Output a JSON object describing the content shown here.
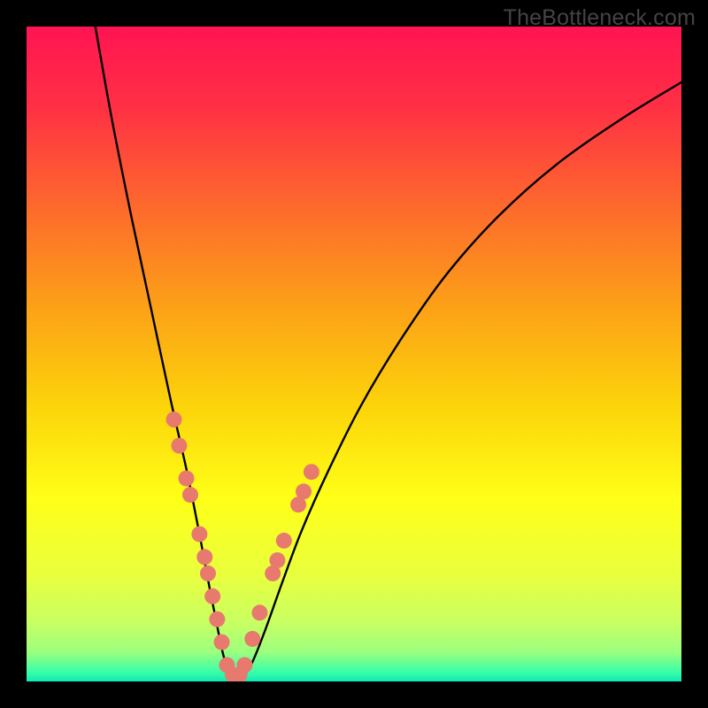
{
  "watermark": "TheBottleneck.com",
  "colors": {
    "frame": "#000000",
    "curve": "#000000",
    "marker_fill": "#e8796f",
    "marker_stroke": "#c95b53",
    "gradient_stops": [
      {
        "offset": 0.0,
        "color": "#ff1452"
      },
      {
        "offset": 0.12,
        "color": "#ff2f45"
      },
      {
        "offset": 0.28,
        "color": "#fd6b2c"
      },
      {
        "offset": 0.44,
        "color": "#fca516"
      },
      {
        "offset": 0.58,
        "color": "#fcd40a"
      },
      {
        "offset": 0.72,
        "color": "#ffff17"
      },
      {
        "offset": 0.84,
        "color": "#e8ff3f"
      },
      {
        "offset": 0.91,
        "color": "#c8ff62"
      },
      {
        "offset": 0.955,
        "color": "#9cff7e"
      },
      {
        "offset": 0.985,
        "color": "#3bffa7"
      },
      {
        "offset": 1.0,
        "color": "#11e8b7"
      }
    ]
  },
  "chart_data": {
    "type": "line",
    "title": "",
    "xlabel": "",
    "ylabel": "",
    "xlim": [
      0,
      100
    ],
    "ylim": [
      0,
      100
    ],
    "note": "Axes have no visible tick labels; values are estimated relative fractions of the plot area. The curve is a V-shaped bottleneck profile with its minimum near x≈31.",
    "series": [
      {
        "name": "bottleneck-curve",
        "x": [
          10.5,
          13,
          16,
          19,
          22,
          24.5,
          26.5,
          28,
          29.2,
          30.2,
          31.5,
          33,
          34.5,
          36.5,
          39,
          42,
          46,
          51,
          57,
          64,
          72,
          81,
          91,
          100
        ],
        "y": [
          100,
          86,
          71,
          57,
          43,
          32,
          22,
          14,
          8,
          3.5,
          0.8,
          0.8,
          3,
          8,
          15,
          23,
          32,
          42,
          52,
          62,
          71,
          79,
          86,
          91.5
        ]
      }
    ],
    "markers": {
      "name": "highlighted-points",
      "points": [
        {
          "x": 22.5,
          "y": 40
        },
        {
          "x": 23.3,
          "y": 36
        },
        {
          "x": 24.4,
          "y": 31
        },
        {
          "x": 25.0,
          "y": 28.5
        },
        {
          "x": 26.4,
          "y": 22.5
        },
        {
          "x": 27.2,
          "y": 19
        },
        {
          "x": 27.7,
          "y": 16.5
        },
        {
          "x": 28.4,
          "y": 13
        },
        {
          "x": 29.1,
          "y": 9.5
        },
        {
          "x": 29.8,
          "y": 6
        },
        {
          "x": 30.6,
          "y": 2.5
        },
        {
          "x": 31.5,
          "y": 1.0
        },
        {
          "x": 32.5,
          "y": 1.0
        },
        {
          "x": 33.3,
          "y": 2.5
        },
        {
          "x": 34.5,
          "y": 6.5
        },
        {
          "x": 35.6,
          "y": 10.5
        },
        {
          "x": 37.6,
          "y": 16.5
        },
        {
          "x": 38.3,
          "y": 18.5
        },
        {
          "x": 39.3,
          "y": 21.5
        },
        {
          "x": 41.5,
          "y": 27
        },
        {
          "x": 42.3,
          "y": 29
        },
        {
          "x": 43.5,
          "y": 32
        }
      ]
    }
  }
}
